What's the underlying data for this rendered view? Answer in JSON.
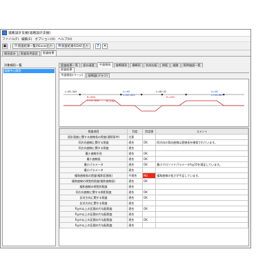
{
  "window": {
    "title": "道路設計支援(道路設計支援)"
  },
  "menu": [
    "ファイル(F)",
    "編集(E)",
    "オプション(O)",
    "ヘルプ(H)"
  ],
  "toolbar": {
    "export_list_label": "照査結果一覧のExcel出力",
    "export_dxf_label": "照査結果のDXF出力",
    "help_glyph": "?",
    "close_glyph": "✕"
  },
  "main_tabs": [
    "線形設計",
    "照査条件設定",
    "照査結果"
  ],
  "left": {
    "title": "対象線形一覧",
    "items": [
      "道路中心線形"
    ]
  },
  "subtabs_row1": [
    "照査結果一覧",
    "設計速度",
    "平面線形",
    "縦断線形",
    "横断形",
    "合成勾配",
    "視距",
    "道路",
    "照明施設一覧"
  ],
  "subtabs_row2": [
    "照査結果"
  ],
  "subtabs_row3": [
    "平面線形(ページ)",
    "縦断図(グラフ)"
  ],
  "diagram": {
    "labels": [
      {
        "text": "L=81.345",
        "cls": "black"
      },
      {
        "text": "R=600",
        "cls": ""
      },
      {
        "text": "A=60",
        "cls": "blue"
      },
      {
        "text": "L=65.403",
        "cls": "blue"
      },
      {
        "text": "R=150",
        "cls": ""
      },
      {
        "text": "L=37.638",
        "cls": ""
      },
      {
        "text": "L=60.02",
        "cls": "black"
      },
      {
        "text": "R=450",
        "cls": ""
      },
      {
        "text": "A=80",
        "cls": "blue"
      },
      {
        "text": "L=26.667",
        "cls": "blue"
      }
    ]
  },
  "table": {
    "headers": [
      "照査項目",
      "判定",
      "判定値",
      "コメント"
    ],
    "rows": [
      {
        "item": "設計速度に関する曲線長の照査(連続条件)",
        "judge": "注意",
        "value": "",
        "comment": ""
      },
      {
        "item": "同方向曲線に関する照査",
        "judge": "適合",
        "value": "OK",
        "comment": "同方向の背向曲線は直線長を確保されています。"
      },
      {
        "item": "同方向曲線に関する照査",
        "judge": "適合",
        "value": "",
        "comment": ""
      },
      {
        "item": "最小曲線半径",
        "judge": "適合",
        "value": "OK",
        "comment": ""
      },
      {
        "item": "最小曲線長",
        "judge": "適合",
        "value": "OK",
        "comment": ""
      },
      {
        "item": "最小パラメータ",
        "judge": "適合",
        "value": "OK",
        "comment": "最小クロソイドパラメータA≧35を満足しています。"
      },
      {
        "item": "最小パラメータ",
        "judge": "適合",
        "value": "",
        "comment": ""
      },
      {
        "item": "緩和曲線長の照査(緩和区間長)",
        "judge": "不適合",
        "value": "NG",
        "comment": "緩和曲線の長さが不足しています。"
      },
      {
        "item": "緩和曲線の視覚的照査(緩和曲線長)",
        "judge": "適合",
        "value": "OK",
        "comment": ""
      },
      {
        "item": "緩和曲線の視覚的照査",
        "judge": "適合",
        "value": "",
        "comment": ""
      },
      {
        "item": "同方向曲線に関する視距照査",
        "judge": "適合",
        "value": "OK",
        "comment": ""
      },
      {
        "item": "反対方向に関する照査",
        "judge": "適合",
        "value": "OK",
        "comment": ""
      },
      {
        "item": "反対方向に関する照査",
        "judge": "適合",
        "value": "",
        "comment": ""
      },
      {
        "item": "R≧m以上の区間の片勾配照査",
        "judge": "適合",
        "value": "OK",
        "comment": ""
      },
      {
        "item": "R≧m以上の区間の片勾配照査",
        "judge": "適合",
        "value": "",
        "comment": ""
      },
      {
        "item": "R≧m以上の区間の片勾配照査",
        "judge": "適合",
        "value": "OK",
        "comment": ""
      },
      {
        "item": "R≧m以上の区間の片勾配照査",
        "judge": "適合",
        "value": "",
        "comment": ""
      }
    ]
  }
}
